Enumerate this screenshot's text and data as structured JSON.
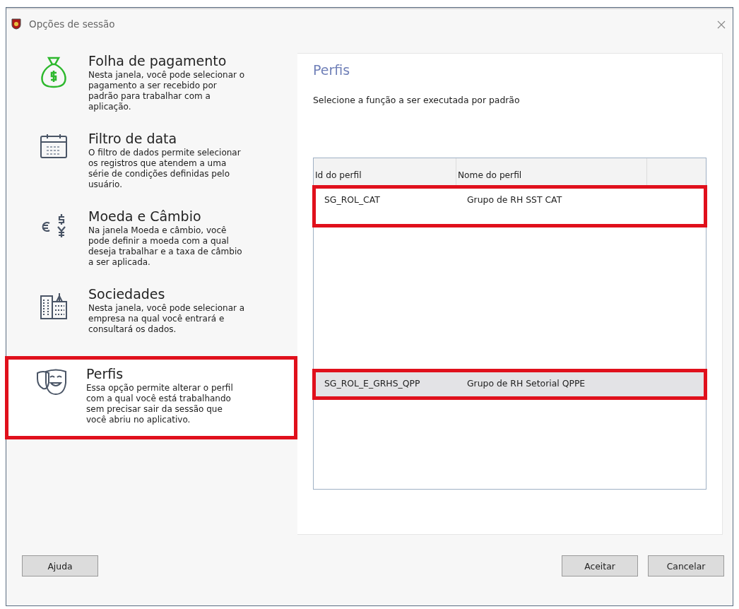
{
  "window": {
    "title": "Opções de sessão"
  },
  "sidebar": {
    "items": [
      {
        "kind": "money",
        "title": "Folha de pagamento",
        "description": "Nesta janela, você pode selecionar o pagamento a ser recebido por padrão para trabalhar com a aplicação.",
        "selected": false,
        "highlighted": false
      },
      {
        "kind": "calendar",
        "title": "Filtro de data",
        "description": "O filtro de dados permite selecionar os registros que atendem a uma série de condições definidas pelo usuário.",
        "selected": false,
        "highlighted": false
      },
      {
        "kind": "currency",
        "title": "Moeda e Câmbio",
        "description": "Na janela Moeda e câmbio, você pode definir a moeda com a qual deseja trabalhar e a taxa de câmbio a ser aplicada.",
        "selected": false,
        "highlighted": false
      },
      {
        "kind": "buildings",
        "title": "Sociedades",
        "description": "Nesta janela, você pode selecionar a empresa na qual você entrará e consultará os dados.",
        "selected": false,
        "highlighted": false
      },
      {
        "kind": "masks",
        "title": "Perfis",
        "description": "Essa opção permite alterar o perfil com a qual você está trabalhando sem precisar sair da sessão que você abriu no aplicativo.",
        "selected": true,
        "highlighted": true
      }
    ]
  },
  "panel": {
    "title": "Perfis",
    "instruction": "Selecione a função a ser executada por padrão",
    "table": {
      "columns": [
        "Id do perfil",
        "Nome do perfil"
      ],
      "rows": [
        {
          "cells": [
            "SG_ROL_CAT",
            "Grupo de RH SST CAT"
          ],
          "selected": false,
          "highlighted": true
        },
        {
          "cells": [
            "SG_ROL_E_GRHS_QPP",
            "Grupo de RH Setorial QPPE"
          ],
          "selected": true,
          "highlighted": true
        }
      ]
    }
  },
  "buttons": {
    "left": [
      "Ajuda"
    ],
    "right": [
      "Aceitar",
      "Cancelar"
    ]
  }
}
